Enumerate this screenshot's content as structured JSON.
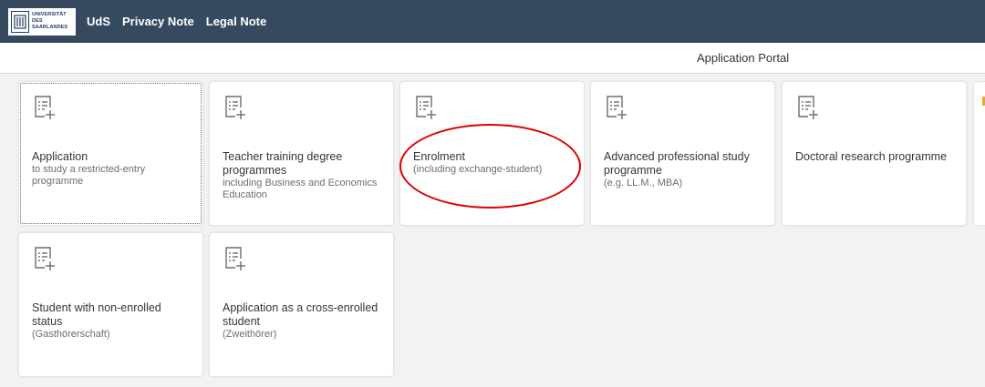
{
  "header": {
    "logo_lines": [
      "UNIVERSITÄT",
      "DES",
      "SAARLANDES"
    ],
    "nav": [
      {
        "label": "UdS"
      },
      {
        "label": "Privacy Note"
      },
      {
        "label": "Legal Note"
      }
    ]
  },
  "subheader": {
    "title": "Application Portal"
  },
  "colors": {
    "header_bg": "#354a5f",
    "annotation": "#e00000"
  },
  "tiles": [
    {
      "icon": "form-add-icon",
      "title": "Application",
      "subtitle": "to study a restricted-entry programme"
    },
    {
      "icon": "form-add-icon",
      "title": "Teacher training degree programmes",
      "subtitle": "including Business and Economics Education"
    },
    {
      "icon": "form-add-icon",
      "title": "Enrolment",
      "subtitle": "(including exchange-student)"
    },
    {
      "icon": "form-add-icon",
      "title": "Advanced professional study programme",
      "subtitle": "(e.g. LL.M., MBA)"
    },
    {
      "icon": "form-add-icon",
      "title": "Doctoral research programme",
      "subtitle": ""
    },
    {
      "icon": "form-add-icon",
      "title": "Student with non-enrolled status",
      "subtitle": "(Gasthörerschaft)"
    },
    {
      "icon": "form-add-icon",
      "title": "Application as a cross-enrolled student",
      "subtitle": "(Zweithörer)"
    }
  ]
}
